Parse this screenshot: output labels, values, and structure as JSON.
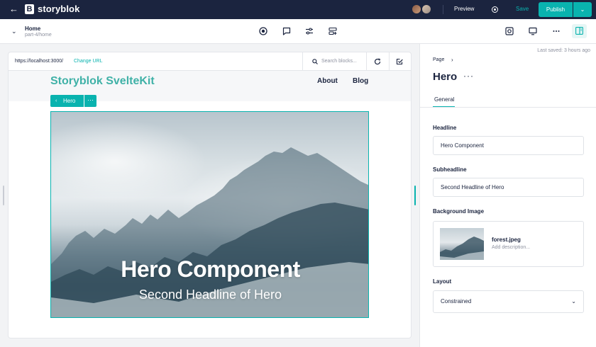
{
  "topbar": {
    "logo_letter": "B",
    "logo_text": "storyblok",
    "preview_label": "Preview",
    "save_label": "Save",
    "publish_label": "Publish",
    "accent": "#09b3af",
    "background": "#1b243f"
  },
  "story": {
    "name": "Home",
    "slug": "part-4/home"
  },
  "toolbar": {
    "icons": [
      "record-icon",
      "comment-icon",
      "sliders-icon",
      "block-list-icon"
    ],
    "right_icons": [
      "visual-editor-icon",
      "desktop-icon",
      "more-icon",
      "panel-layout-icon"
    ]
  },
  "url_bar": {
    "url": "https://localhost:3000/",
    "change_url_label": "Change URL",
    "search_placeholder": "Search blocks..."
  },
  "site": {
    "title": "Storyblok SvelteKit",
    "nav": [
      "About",
      "Blog"
    ],
    "title_color": "#3fb1a7"
  },
  "block_tag": {
    "label": "Hero"
  },
  "hero": {
    "headline": "Hero Component",
    "subheadline": "Second Headline of Hero"
  },
  "panel": {
    "last_saved": "Last saved: 3 hours ago",
    "breadcrumb": "Page",
    "block_name": "Hero",
    "tab": "General",
    "fields": {
      "headline_label": "Headline",
      "headline_value": "Hero Component",
      "subheadline_label": "Subheadline",
      "subheadline_value": "Second Headline of Hero",
      "background_label": "Background Image",
      "asset_name": "forest.jpeg",
      "asset_desc_placeholder": "Add description...",
      "layout_label": "Layout",
      "layout_value": "Constrained"
    }
  }
}
